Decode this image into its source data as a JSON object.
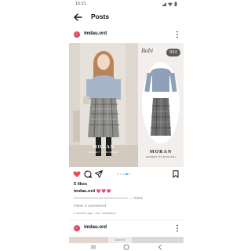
{
  "status_bar": {
    "time": "15:21",
    "icons": [
      "signal-icon",
      "wifi-icon",
      "battery-icon"
    ]
  },
  "top_bar": {
    "back_icon": "back-arrow-icon",
    "title": "Posts"
  },
  "post": {
    "username": "imdau.ord",
    "media": {
      "counter": "9/10",
      "brand_left": "MORAN",
      "brand_left_sub": "MOMENT OF MORANDI",
      "brand_script": "Babi",
      "brand_right": "MORAN",
      "brand_right_sub": "MOMENT OF MORANDI",
      "carousel_total": 10,
      "carousel_active": 9
    },
    "likes": "5 likes",
    "caption_user": "imdau.ord",
    "caption_hearts": "💗💗💗",
    "caption_line": "---------------------------------------",
    "more_label": "... more",
    "view_comments": "View 1 comment",
    "meta": "5 minutes ago · See Translation",
    "colors": {
      "like_red": "#ed4956",
      "dot_active": "#3897f0",
      "avatar": "#d43a53"
    }
  },
  "post2": {
    "username": "imdau.ord",
    "media_script": "Babirelle"
  },
  "nav_bar": {
    "icons": [
      "recent-apps-icon",
      "home-icon",
      "back-icon"
    ]
  }
}
